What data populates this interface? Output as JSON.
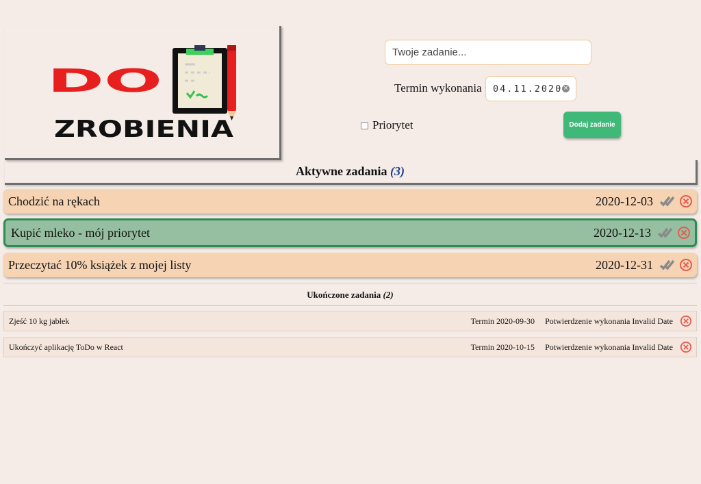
{
  "logo": {
    "line1": "DO",
    "line2": "ZROBIENIA"
  },
  "form": {
    "task_placeholder": "Twoje zadanie...",
    "date_label": "Termin wykonania",
    "date_value": "04.11.2020",
    "priority_label": "Priorytet",
    "add_label": "Dodaj zadanie"
  },
  "active": {
    "title": "Aktywne zadania",
    "count": "(3)",
    "tasks": [
      {
        "name": "Chodzić na rękach",
        "date": "2020-12-03",
        "priority": false
      },
      {
        "name": "Kupić mleko - mój priorytet",
        "date": "2020-12-13",
        "priority": true
      },
      {
        "name": "Przeczytać 10% książek z mojej listy",
        "date": "2020-12-31",
        "priority": false
      }
    ]
  },
  "done": {
    "title": "Ukończone zadania",
    "count": "(2)",
    "tasks": [
      {
        "name": "Zjeść 10 kg jabłek",
        "term": "Termin 2020-09-30",
        "confirm": "Potwierdzenie wykonania Invalid Date"
      },
      {
        "name": "Ukończyć aplikację ToDo w React",
        "term": "Termin 2020-10-15",
        "confirm": "Potwierdzenie wykonania Invalid Date"
      }
    ]
  },
  "colors": {
    "accent_green": "#3fb878",
    "task_bg": "#f5d3b3",
    "priority_bg": "#95bfa0",
    "delete_red": "#e85a4f"
  }
}
